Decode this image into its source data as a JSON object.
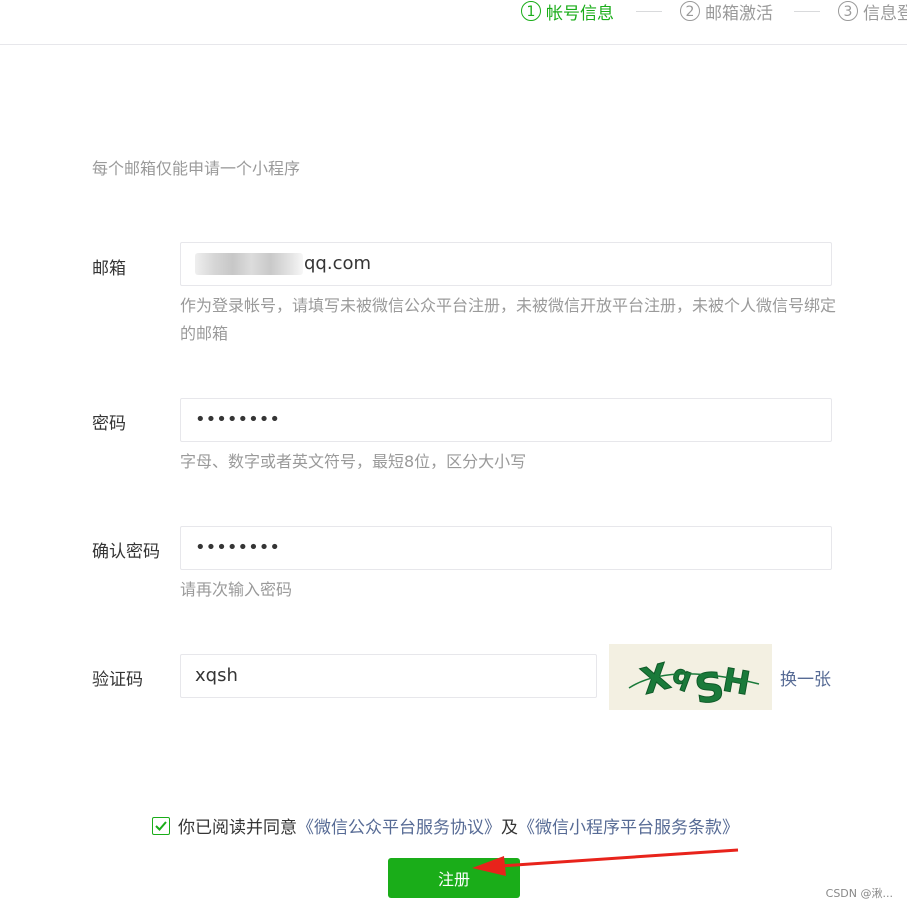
{
  "steps": [
    {
      "num": "1",
      "label": "帐号信息",
      "active": true
    },
    {
      "num": "2",
      "label": "邮箱激活",
      "active": false
    },
    {
      "num": "3",
      "label": "信息登记",
      "active": false
    }
  ],
  "form": {
    "tip": "每个邮箱仅能申请一个小程序",
    "email": {
      "label": "邮箱",
      "value_visible": "qq.com",
      "hint": "作为登录帐号，请填写未被微信公众平台注册，未被微信开放平台注册，未被个人微信号绑定的邮箱"
    },
    "password": {
      "label": "密码",
      "value": "••••••••",
      "hint": "字母、数字或者英文符号，最短8位，区分大小写"
    },
    "confirm_password": {
      "label": "确认密码",
      "value": "••••••••",
      "hint": "请再次输入密码"
    },
    "captcha": {
      "label": "验证码",
      "value": "xqsh",
      "image_text": "XqSH",
      "refresh_link": "换一张"
    }
  },
  "agreement": {
    "prefix": "你已阅读并同意",
    "link1": "《微信公众平台服务协议》",
    "conjunction": "及",
    "link2": "《微信小程序平台服务条款》",
    "checked": true
  },
  "submit_label": "注册",
  "watermark": "CSDN @湫...",
  "colors": {
    "primary": "#1aad19",
    "link": "#576b95",
    "hint": "#9a9a9a",
    "annotation_arrow": "#e8231b"
  },
  "icons": {
    "checkbox": "check-icon",
    "annotation": "red-arrow-icon"
  }
}
